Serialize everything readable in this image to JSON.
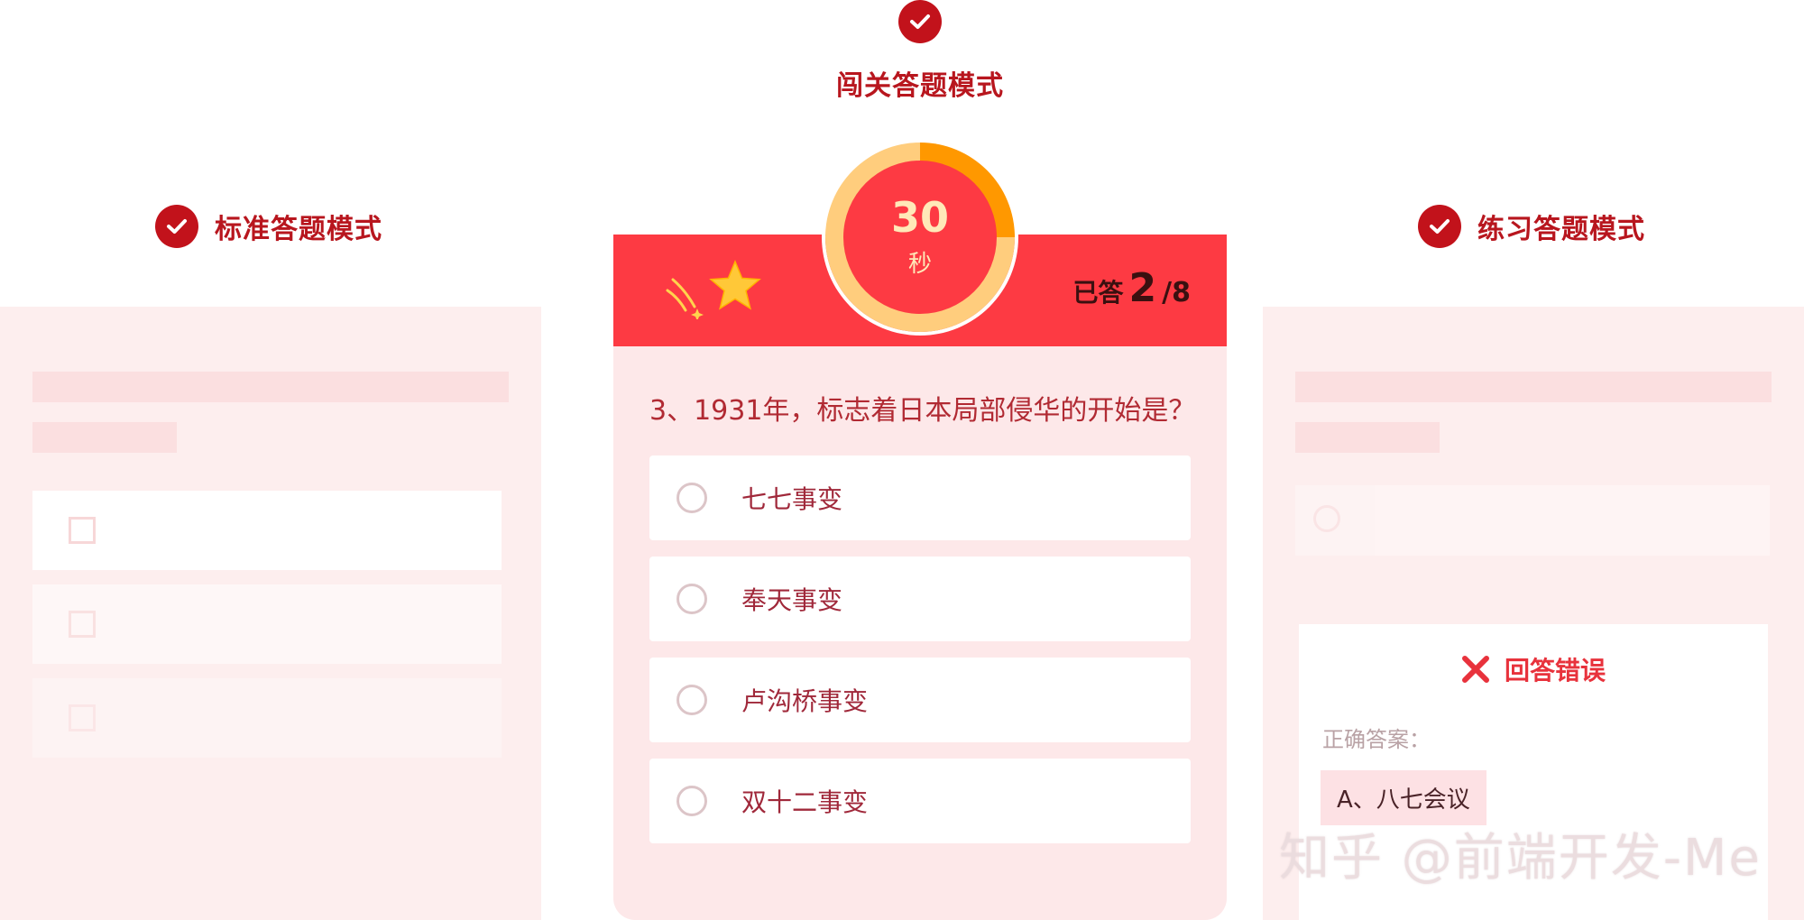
{
  "modes": {
    "standard": {
      "title": "标准答题模式"
    },
    "challenge": {
      "title": "闯关答题模式"
    },
    "practice": {
      "title": "练习答题模式"
    }
  },
  "timer": {
    "value": "30",
    "unit": "秒",
    "elapsed_fraction": 0.25
  },
  "progress": {
    "label": "已答",
    "current": "2",
    "total": "/8"
  },
  "question": {
    "text": "3、1931年，标志着日本局部侵华的开始是？",
    "options": [
      "七七事变",
      "奉天事变",
      "卢沟桥事变",
      "双十二事变"
    ]
  },
  "result": {
    "status": "回答错误",
    "correct_label": "正确答案：",
    "correct_answer": "A、八七会议"
  },
  "watermark": "知乎 @前端开发-Me",
  "colors": {
    "brand_red": "#c2121b",
    "bar_red": "#fd3a43",
    "panel_pink": "#fdeeee",
    "timer_orange": "#ff9800"
  },
  "icons": [
    "check-icon",
    "star-icon",
    "sparkle-icon",
    "close-x-icon"
  ]
}
